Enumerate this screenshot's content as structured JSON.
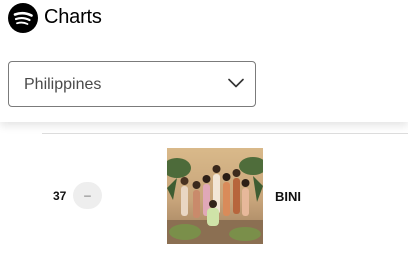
{
  "header": {
    "logo_icon": "spotify-logo-icon",
    "title": "Charts"
  },
  "country_select": {
    "selected": "Philippines",
    "icon": "chevron-down-icon"
  },
  "chart_rows": [
    {
      "rank": "37",
      "status": "–",
      "status_icon": "no-change-icon",
      "artist": "BINI"
    }
  ],
  "colors": {
    "brand": "#000000",
    "select_border": "#7b7b7b",
    "badge_bg": "#eeeeee"
  }
}
